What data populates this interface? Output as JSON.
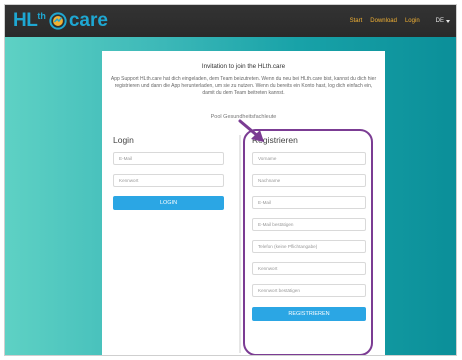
{
  "header": {
    "logo": {
      "hl": "HL",
      "th": "th",
      "care": "care"
    },
    "nav": [
      "Start",
      "Download",
      "Login"
    ],
    "language": "DE"
  },
  "card": {
    "title": "Invitation to join the HLth.care",
    "intro": "App Support HLth.care hat dich eingeladen, dem Team beizutreten. Wenn du neu bei HLth.care bist, kannst du dich hier registrieren und dann die App herunterladen, um sie zu nutzen. Wenn du bereits ein Konto hast, log dich einfach ein, damit du dem Team beitreten kannst.",
    "pool": "Pool Gesundheitsfachleute"
  },
  "login": {
    "heading": "Login",
    "email_placeholder": "E-Mail",
    "password_placeholder": "Kennwort",
    "button": "LOGIN"
  },
  "register": {
    "heading": "Registrieren",
    "fields": [
      "Vorname",
      "Nachname",
      "E-Mail",
      "E-Mail bestätigen",
      "Telefon (keine Pflichtangabe)",
      "Kennwort",
      "Kennwort bestätigen"
    ],
    "button": "REGISTRIEREN"
  },
  "colors": {
    "brand": "#1ea7d2",
    "nav_link": "#f2b134",
    "button": "#2ba6e4",
    "highlight": "#7b3c93"
  }
}
